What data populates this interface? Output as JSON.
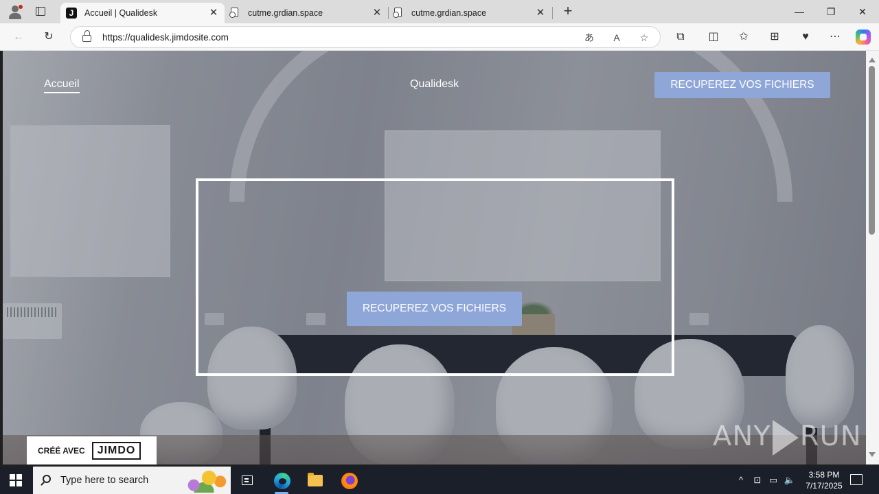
{
  "browser": {
    "tabs": [
      {
        "title": "Accueil | Qualidesk",
        "favicon": "J",
        "active": true
      },
      {
        "title": "cutme.grdian.space",
        "active": false
      },
      {
        "title": "cutme.grdian.space",
        "active": false
      }
    ],
    "address": {
      "url": "https://qualidesk.jimdosite.com"
    }
  },
  "page": {
    "nav": {
      "home_label": "Accueil",
      "site_title": "Qualidesk",
      "cta_label": "RECUPEREZ VOS FICHIERS"
    },
    "hero": {
      "cta_label": "RECUPEREZ VOS FICHIERS"
    },
    "badge": {
      "prefix": "CRÉÉ AVEC",
      "brand": "JIMDO"
    },
    "accent_color": "#8ea6d8"
  },
  "watermark": {
    "left": "ANY",
    "right": "RUN"
  },
  "taskbar": {
    "search_placeholder": "Type here to search",
    "time": "3:58 PM",
    "date": "7/17/2025"
  }
}
